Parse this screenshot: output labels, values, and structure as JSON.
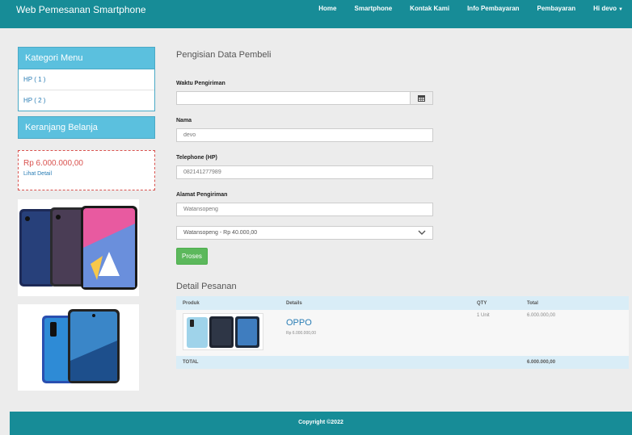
{
  "navbar": {
    "brand": "Web Pemesanan Smartphone",
    "items": [
      {
        "label": "Home"
      },
      {
        "label": "Smartphone"
      },
      {
        "label": "Kontak Kami"
      },
      {
        "label": "Info Pembayaran"
      },
      {
        "label": "Pembayaran"
      },
      {
        "label": "Hi devo"
      }
    ]
  },
  "sidebar": {
    "category_title": "Kategori Menu",
    "categories": [
      {
        "label": "HP ( 1 )"
      },
      {
        "label": "HP ( 2 )"
      }
    ],
    "cart_title": "Keranjang Belanja",
    "cart_total": "Rp 6.000.000,00",
    "cart_link": "Lihat Detail"
  },
  "form": {
    "title": "Pengisian Data Pembeli",
    "shipping_time_label": "Waktu Pengiriman",
    "shipping_time_value": "",
    "name_label": "Nama",
    "name_value": "devo",
    "phone_label": "Telephone (HP)",
    "phone_value": "082141277989",
    "address_label": "Alamat Pengiriman",
    "address_value": "Watansopeng",
    "shipping_option": "Watansopeng - Rp 40.000,00",
    "submit_label": "Proses"
  },
  "order_detail": {
    "title": "Detail Pesanan",
    "columns": [
      "Produk",
      "Details",
      "QTY",
      "Total"
    ],
    "items": [
      {
        "name": "OPPO",
        "price": "Rp 6.000.000,00",
        "qty": "1 Unit",
        "total": "6.000.000,00"
      }
    ],
    "footer_label": "TOTAL",
    "footer_total": "6.000.000,00"
  },
  "footer": {
    "text": "Copyright ©2022"
  },
  "colors": {
    "primary": "#178c97",
    "info": "#5bc0de",
    "success": "#5cb85c",
    "danger": "#d9534f"
  }
}
